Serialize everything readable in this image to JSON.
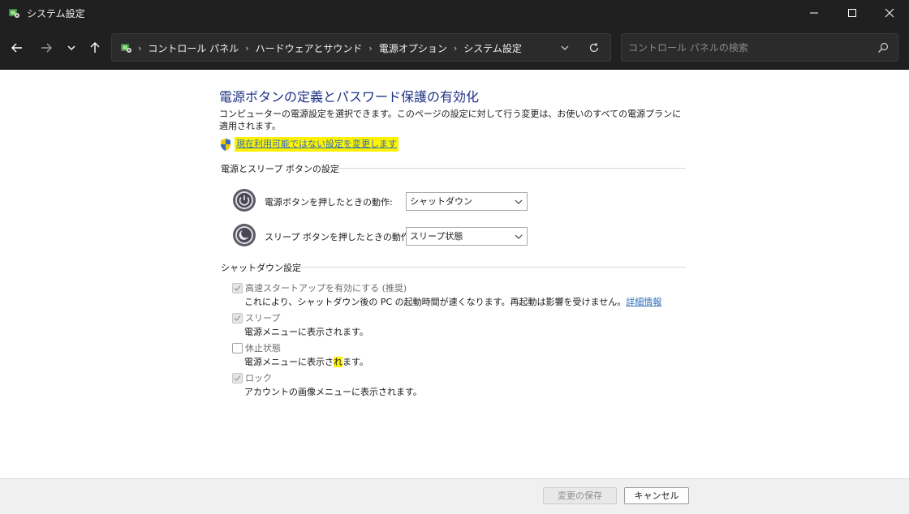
{
  "window": {
    "title": "システム設定",
    "controls": [
      "minimize-icon",
      "maximize-icon",
      "close-icon"
    ]
  },
  "address_bar": {
    "breadcrumbs": [
      "コントロール パネル",
      "ハードウェアとサウンド",
      "電源オプション",
      "システム設定"
    ]
  },
  "search": {
    "placeholder": "コントロール パネルの検索"
  },
  "main": {
    "title": "電源ボタンの定義とパスワード保護の有効化",
    "description": "コンピューターの電源設定を選択できます。このページの設定に対して行う変更は、お使いのすべての電源プランに適用されます。",
    "change_link": "現在利用可能ではない設定を変更します",
    "power_group": {
      "label": "電源とスリープ ボタンの設定",
      "power_button": {
        "label": "電源ボタンを押したときの動作:",
        "selected": "シャットダウン"
      },
      "sleep_button": {
        "label": "スリープ ボタンを押したときの動作:",
        "selected": "スリープ状態"
      }
    },
    "shutdown_group": {
      "label": "シャットダウン設定",
      "options": [
        {
          "label": "高速スタートアップを有効にする (推奨)",
          "description": "これにより、シャットダウン後の PC の起動時間が速くなります。再起動は影響を受けません。",
          "link": "詳細情報",
          "checked": true
        },
        {
          "label": "スリープ",
          "description": "電源メニューに表示されます。",
          "checked": true
        },
        {
          "label": "休止状態",
          "description_a": "電源メニューに表示さ",
          "description_hl": "れ",
          "description_b": "ます。",
          "checked": false
        },
        {
          "label": "ロック",
          "description": "アカウントの画像メニューに表示されます。",
          "checked": true
        }
      ]
    }
  },
  "footer": {
    "save_label": "変更の保存",
    "cancel_label": "キャンセル"
  },
  "colors": {
    "titlebar": "#202020",
    "title_text": "#1e3287",
    "link": "#2f6fba",
    "highlight": "#fff200"
  }
}
